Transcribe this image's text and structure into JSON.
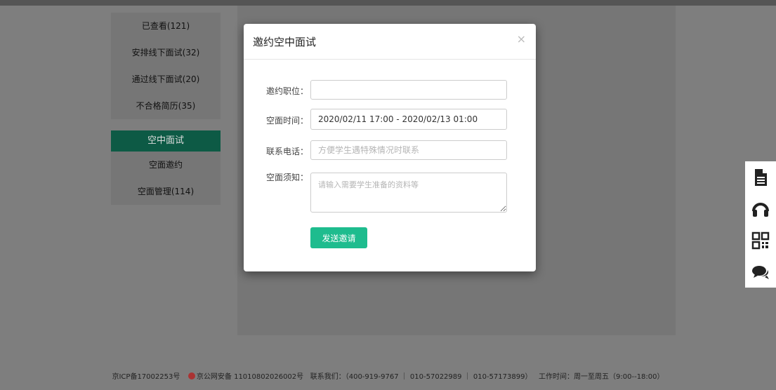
{
  "sidebar": {
    "group1": [
      {
        "label": "已查看(121)"
      },
      {
        "label": "安排线下面试(32)"
      },
      {
        "label": "通过线下面试(20)"
      },
      {
        "label": "不合格简历(35)"
      }
    ],
    "section_title": "空中面试",
    "group2": [
      {
        "label": "空面邀约"
      },
      {
        "label": "空面管理(114)"
      }
    ]
  },
  "modal": {
    "title": "邀约空中面试",
    "close_icon": "×",
    "fields": {
      "position_label": "邀约职位：",
      "position_value": "",
      "time_label": "空面时间：",
      "time_value": "2020/02/11 17:00 - 2020/02/13 01:00",
      "phone_label": "联系电话：",
      "phone_placeholder": "方便学生遇特殊情况时联系",
      "notice_label": "空面须知：",
      "notice_placeholder": "请输入需要学生准备的资料等"
    },
    "submit_label": "发送邀请"
  },
  "footer": {
    "icp": "京ICP备17002253号",
    "police": "京公网安备 11010802026002号",
    "contact": "联系我们：（400-919-9767 ｜ 010-57022989 ｜ 010-57173899）",
    "hours": "工作时间：周一至周五（9:00--18:00）"
  },
  "right_toolbar": {
    "icons": [
      "document-icon",
      "headset-icon",
      "qrcode-icon",
      "chat-icon"
    ]
  },
  "colors": {
    "accent": "#1ebc8e",
    "overlay": "#7e7e7e",
    "nav_active": "#0d5a45"
  }
}
